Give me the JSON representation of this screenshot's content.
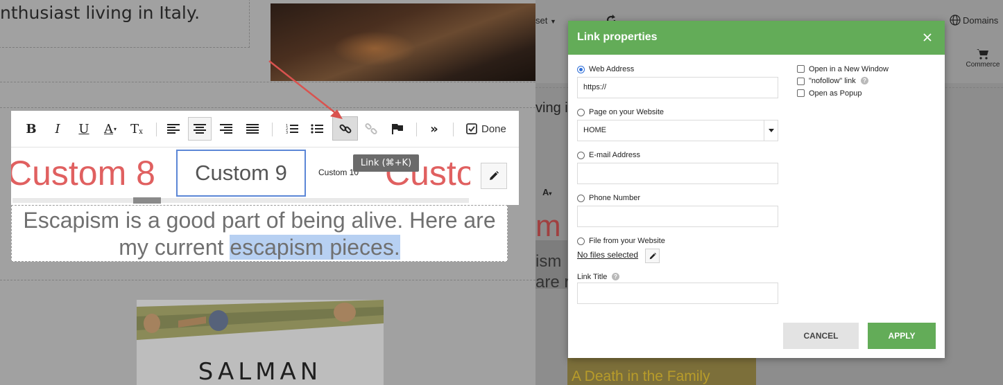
{
  "left": {
    "intro_text": "nthusiast living in Italy.",
    "toolbar": {
      "bold": "B",
      "italic": "I",
      "underline": "U",
      "font_color": "A",
      "clear_format": "T",
      "done_label": "Done"
    },
    "fonts": {
      "custom8": "Custom 8",
      "custom9": "Custom 9",
      "custom10": "Custom 10",
      "custom11_partial": "Custo"
    },
    "tooltip": "Link (⌘+K)",
    "escapism": {
      "text_before": "Escapism is a good part of being alive. Here are my current ",
      "text_selected": "escapism pieces."
    },
    "book_title": "SALMAN"
  },
  "right": {
    "background": {
      "reset_menu": "set",
      "domains": "Domains",
      "commerce": "Commerce",
      "living_partial": "ving i",
      "custom_partial": "m",
      "ism_partial": "ism",
      "are_partial": "are r",
      "book_subtitle": "A Death in the Family"
    },
    "modal": {
      "title": "Link properties",
      "web_address_label": "Web Address",
      "web_address_value": "https://",
      "page_label": "Page on your Website",
      "page_value": "HOME",
      "email_label": "E-mail Address",
      "phone_label": "Phone Number",
      "file_label": "File from your Website",
      "no_files": "No files selected",
      "link_title_label": "Link Title",
      "new_window_label": "Open in a New Window",
      "nofollow_label": "\"nofollow\" link",
      "popup_label": "Open as Popup",
      "cancel": "CANCEL",
      "apply": "APPLY"
    }
  },
  "colors": {
    "accent_green": "#63ac58",
    "font_red": "#e06060",
    "selection_blue": "#b7d0f2",
    "arrow_red": "#d9534f"
  }
}
